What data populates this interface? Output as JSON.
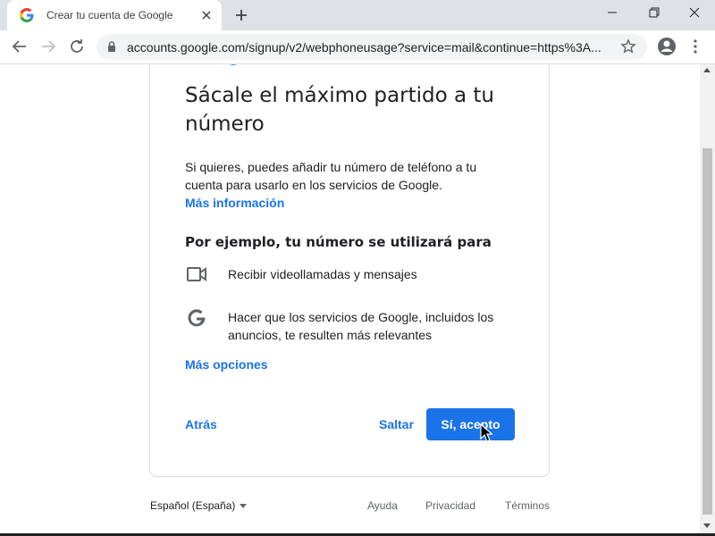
{
  "browser": {
    "tab_title": "Crear tu cuenta de Google",
    "url": "accounts.google.com/signup/v2/webphoneusage?service=mail&continue=https%3A...",
    "icons": [
      "google-favicon-icon",
      "close-icon",
      "plus-icon",
      "minimize-icon",
      "restore-icon",
      "window-close-icon",
      "back-icon",
      "forward-icon",
      "reload-icon",
      "lock-icon",
      "star-icon",
      "account-icon",
      "more-icon"
    ]
  },
  "page": {
    "heading": "Sácale el máximo partido a tu número",
    "description": "Si quieres, puedes añadir tu número de teléfono a tu cuenta para usarlo en los servicios de Google.",
    "more_info_link": "Más información",
    "subheading": "Por ejemplo, tu número se utilizará para",
    "items": [
      {
        "icon": "video-camera-icon",
        "text": "Recibir videollamadas y mensajes"
      },
      {
        "icon": "google-g-icon",
        "text": "Hacer que los servicios de Google, incluidos los anuncios, te resulten más relevantes"
      }
    ],
    "more_options_link": "Más opciones",
    "back_button": "Atrás",
    "skip_button": "Saltar",
    "accept_button": "Sí, acepto"
  },
  "footer": {
    "language": "Español (España)",
    "help": "Ayuda",
    "privacy": "Privacidad",
    "terms": "Términos"
  },
  "colors": {
    "accent": "#1a73e8",
    "titlebar": "#dee1e6",
    "omnibox": "#f1f3f4"
  }
}
